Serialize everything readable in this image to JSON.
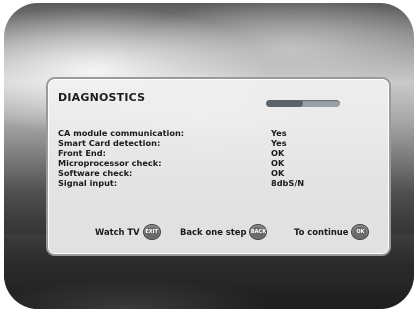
{
  "dialog": {
    "title": "DIAGNOSTICS",
    "signal_level": 0.5
  },
  "diagnostics": [
    {
      "label": "CA module communication:",
      "value": "Yes"
    },
    {
      "label": "Smart Card detection:",
      "value": "Yes"
    },
    {
      "label": "Front End:",
      "value": "OK"
    },
    {
      "label": "Microprocessor check:",
      "value": "OK"
    },
    {
      "label": "Software check:",
      "value": "OK"
    },
    {
      "label": "Signal input:",
      "value": "8dbS/N"
    }
  ],
  "footer": {
    "watch_tv_label": "Watch TV",
    "watch_tv_key": "EXIT",
    "back_label": "Back one step",
    "back_key": "BACK",
    "continue_label": "To continue",
    "continue_key": "OK"
  }
}
